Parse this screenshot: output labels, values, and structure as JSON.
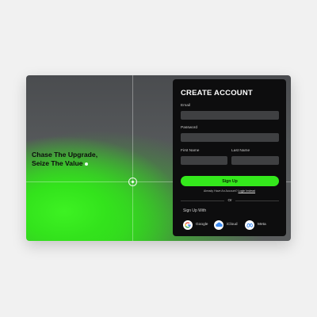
{
  "hero": {
    "line1": "Chase The Upgrade,",
    "line2": "Seize The Value"
  },
  "form": {
    "title": "CREATE ACCOUNT",
    "email_label": "Email",
    "password_label": "Password",
    "first_name_label": "First Name",
    "last_name_label": "Last Name",
    "email_value": "",
    "password_value": "",
    "first_name_value": "",
    "last_name_value": "",
    "signup_label": "Sign Up",
    "already_text": "Already Have An Account?",
    "login_link": "Login Instead",
    "or_text": "Or",
    "signup_with": "Sign Up With",
    "social": [
      {
        "label": "Google",
        "icon": "google-icon"
      },
      {
        "label": "iCloud",
        "icon": "icloud-icon"
      },
      {
        "label": "Meta",
        "icon": "meta-icon"
      }
    ]
  },
  "colors": {
    "accent": "#34e81c",
    "panel": "#0d0d0e",
    "field": "#3f4042"
  }
}
